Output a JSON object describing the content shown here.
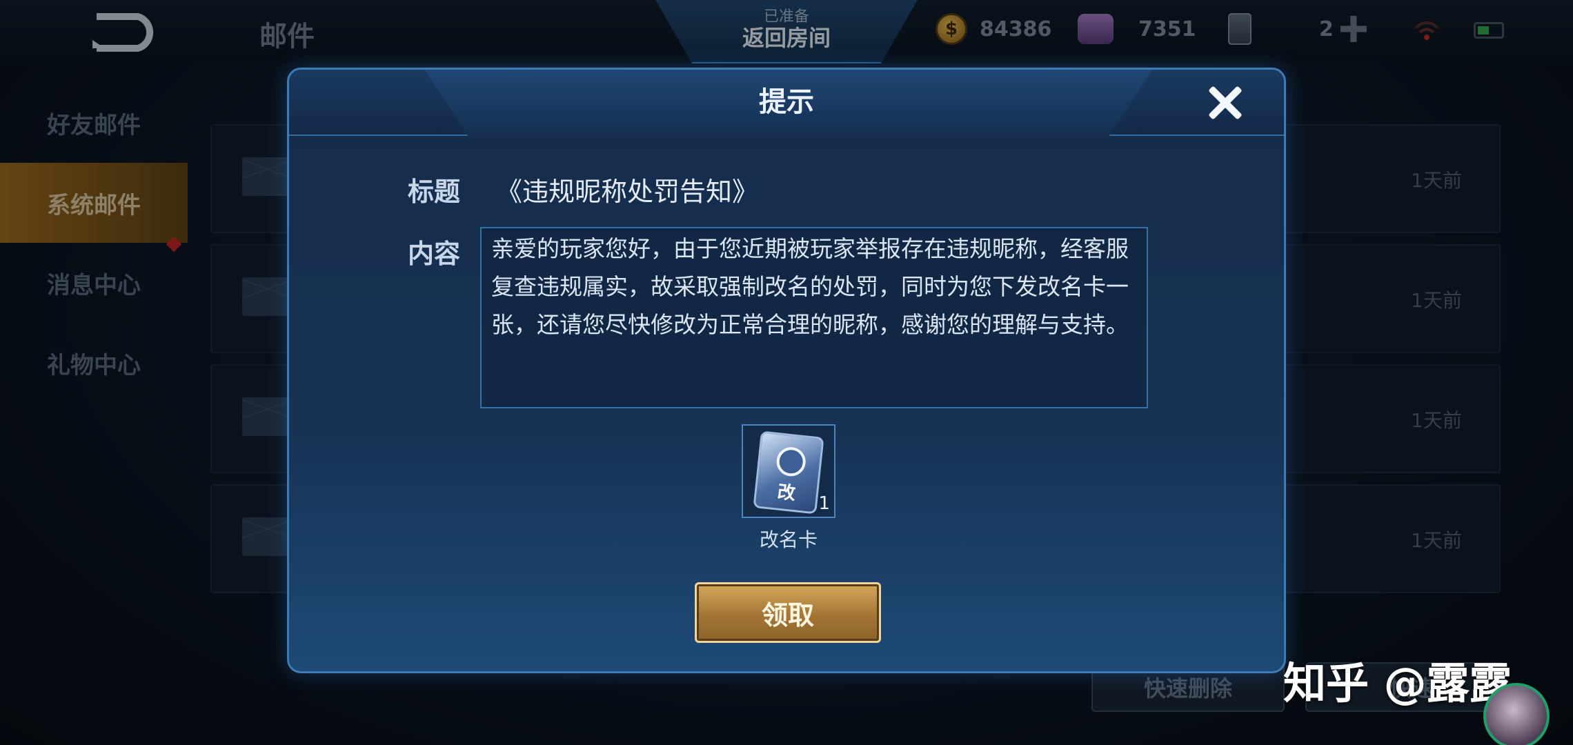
{
  "topbar": {
    "page_title": "邮件",
    "room_status": "已准备",
    "room_label": "返回房间",
    "gold": "84386",
    "gems": "7351",
    "tickets": "2"
  },
  "sidebar": {
    "items": [
      {
        "label": "好友邮件"
      },
      {
        "label": "系统邮件"
      },
      {
        "label": "消息中心"
      },
      {
        "label": "礼物中心"
      }
    ]
  },
  "mail_list": {
    "rows": [
      {
        "time": "1天前"
      },
      {
        "time": "1天前"
      },
      {
        "time": "1天前"
      },
      {
        "time": "1天前"
      }
    ],
    "quick_delete_label": "快速删除",
    "quick_claim_label": "快速"
  },
  "modal": {
    "title": "提示",
    "subject_label": "标题",
    "subject": "《违规昵称处罚告知》",
    "content_label": "内容",
    "content": "亲爱的玩家您好，由于您近期被玩家举报存在违规昵称，经客服复查违规属实，故采取强制改名的处罚，同时为您下发改名卡一张，还请您尽快修改为正常合理的昵称，感谢您的理解与支持。",
    "attachment": {
      "name": "改名卡",
      "count": "1",
      "card_char": "改"
    },
    "claim_label": "领取"
  },
  "watermark": "知乎 @露露"
}
